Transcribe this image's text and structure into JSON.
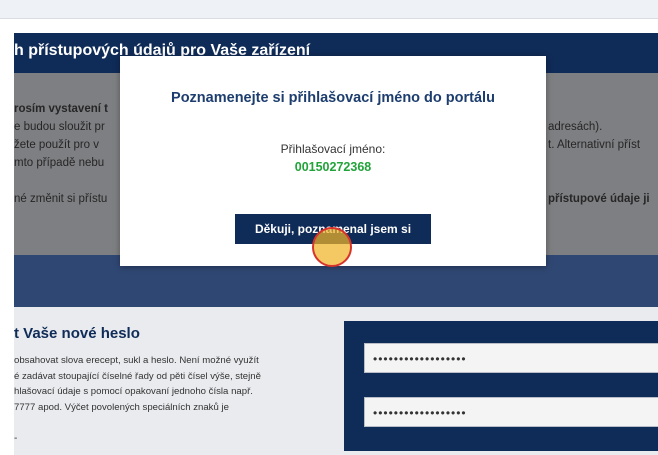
{
  "banner": {
    "title": "h přístupových údajů pro Vaše zařízení"
  },
  "background": {
    "lines_left": [
      "rosím vystavení t",
      "e budou sloužit pr",
      "žete použít pro v",
      "mto případě nebu",
      "né změnit si přístu"
    ],
    "lines_right": [
      "adresách).",
      "t. Alternativní příst",
      "přístupové údaje ji"
    ]
  },
  "password_section": {
    "title": "t Vaše nové heslo",
    "description": [
      "obsahovat slova erecept, sukl a heslo. Není možné využít",
      "é zadávat stoupající číselné řady od pěti čísel výše, stejně",
      "hlašovací údaje s pomocí opakovaní jednoho čísla např.",
      "7777 apod. Výčet povolených speciálních znaků je"
    ],
    "trailing": "-",
    "password_value": "••••••••••••••••••",
    "password_confirm_value": "••••••••••••••••••"
  },
  "modal": {
    "title": "Poznamenejte si přihlašovací jméno do portálu",
    "login_label": "Přihlašovací jméno:",
    "login_value": "00150272368",
    "confirm_button": "Děkuji, poznamenal jsem si"
  },
  "colors": {
    "navy": "#0f2b57",
    "login_green": "#22a33a",
    "modal_title": "#1c3d6e",
    "overlay_gray": "#7e7f82"
  }
}
